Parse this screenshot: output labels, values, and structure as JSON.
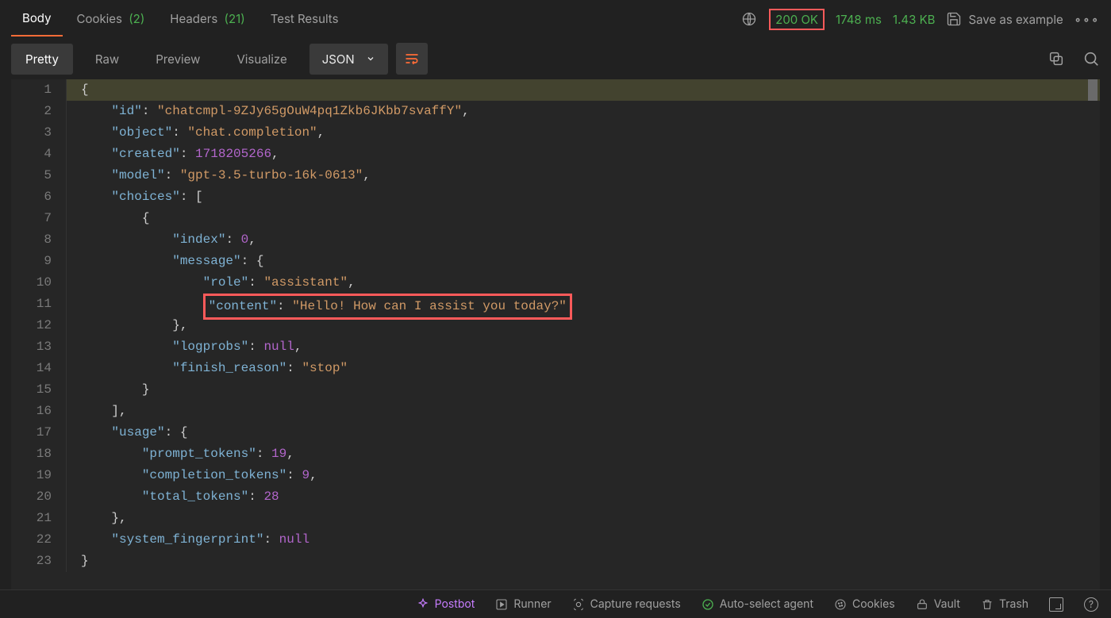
{
  "tabs": {
    "body": "Body",
    "cookies": "Cookies",
    "cookies_count": "(2)",
    "headers": "Headers",
    "headers_count": "(21)",
    "test_results": "Test Results"
  },
  "status": {
    "code": "200 OK",
    "time": "1748 ms",
    "size": "1.43 KB",
    "save_label": "Save as example"
  },
  "view": {
    "pretty": "Pretty",
    "raw": "Raw",
    "preview": "Preview",
    "visualize": "Visualize",
    "format": "JSON"
  },
  "code": {
    "l1": "{",
    "l2_k": "\"id\"",
    "l2_s": "\"chatcmpl-9ZJy65gOuW4pq1Zkb6JKbb7svaffY\"",
    "l3_k": "\"object\"",
    "l3_s": "\"chat.completion\"",
    "l4_k": "\"created\"",
    "l4_n": "1718205266",
    "l5_k": "\"model\"",
    "l5_s": "\"gpt-3.5-turbo-16k-0613\"",
    "l6_k": "\"choices\"",
    "l8_k": "\"index\"",
    "l8_n": "0",
    "l9_k": "\"message\"",
    "l10_k": "\"role\"",
    "l10_s": "\"assistant\"",
    "l11_k": "\"content\"",
    "l11_s": "\"Hello! How can I assist you today?\"",
    "l13_k": "\"logprobs\"",
    "l13_n": "null",
    "l14_k": "\"finish_reason\"",
    "l14_s": "\"stop\"",
    "l17_k": "\"usage\"",
    "l18_k": "\"prompt_tokens\"",
    "l18_n": "19",
    "l19_k": "\"completion_tokens\"",
    "l19_n": "9",
    "l20_k": "\"total_tokens\"",
    "l20_n": "28",
    "l22_k": "\"system_fingerprint\"",
    "l22_n": "null",
    "l23": "}",
    "lnum": [
      "1",
      "2",
      "3",
      "4",
      "5",
      "6",
      "7",
      "8",
      "9",
      "10",
      "11",
      "12",
      "13",
      "14",
      "15",
      "16",
      "17",
      "18",
      "19",
      "20",
      "21",
      "22",
      "23"
    ]
  },
  "footer": {
    "postbot": "Postbot",
    "runner": "Runner",
    "capture": "Capture requests",
    "autoagent": "Auto-select agent",
    "cookies": "Cookies",
    "vault": "Vault",
    "trash": "Trash"
  }
}
